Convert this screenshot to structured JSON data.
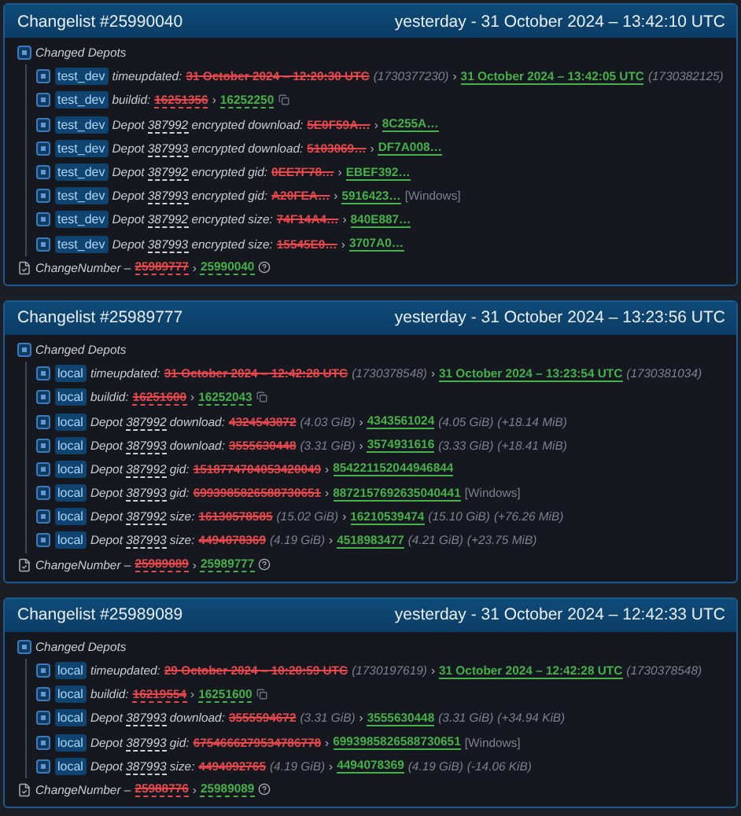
{
  "changelists": [
    {
      "title": "Changelist #25990040",
      "time": "yesterday - 31 October 2024 – 13:42:10 UTC",
      "group": "Changed Depots",
      "rows": [
        {
          "branch": "test_dev",
          "kind": "timestamp",
          "field": "timeupdated:",
          "old": "31 October 2024 – 12:20:30 UTC",
          "old_note": "(1730377230)",
          "arrow": "›",
          "new": "31 October 2024 – 13:42:05 UTC",
          "new_note": "(1730382125)"
        },
        {
          "branch": "test_dev",
          "kind": "buildid",
          "field": "buildid:",
          "old": "16251356",
          "arrow": "›",
          "new": "16252250"
        },
        {
          "branch": "test_dev",
          "kind": "depot",
          "prefix": "Depot",
          "depot": "387992",
          "field": "encrypted download:",
          "old": "5E0F59A…",
          "arrow": "›",
          "new": "8C255A…"
        },
        {
          "branch": "test_dev",
          "kind": "depot",
          "prefix": "Depot",
          "depot": "387993",
          "field": "encrypted download:",
          "old": "5103069…",
          "arrow": "›",
          "new": "DF7A008…"
        },
        {
          "branch": "test_dev",
          "kind": "depot",
          "prefix": "Depot",
          "depot": "387992",
          "field": "encrypted gid:",
          "old": "0EE7F78…",
          "arrow": "›",
          "new": "EBEF392…"
        },
        {
          "branch": "test_dev",
          "kind": "depot",
          "prefix": "Depot",
          "depot": "387993",
          "field": "encrypted gid:",
          "old": "A20FEA…",
          "arrow": "›",
          "new": "5916423…",
          "platform": "[Windows]"
        },
        {
          "branch": "test_dev",
          "kind": "depot",
          "prefix": "Depot",
          "depot": "387992",
          "field": "encrypted size:",
          "old": "74F14A4…",
          "arrow": "›",
          "new": "840E887…"
        },
        {
          "branch": "test_dev",
          "kind": "depot",
          "prefix": "Depot",
          "depot": "387993",
          "field": "encrypted size:",
          "old": "15545E0…",
          "arrow": "›",
          "new": "3707A0…"
        }
      ],
      "change_number": {
        "label": "ChangeNumber –",
        "old": "25989777",
        "arrow": "›",
        "new": "25990040"
      }
    },
    {
      "title": "Changelist #25989777",
      "time": "yesterday - 31 October 2024 – 13:23:56 UTC",
      "group": "Changed Depots",
      "rows": [
        {
          "branch": "local",
          "kind": "timestamp",
          "field": "timeupdated:",
          "old": "31 October 2024 – 12:42:28 UTC",
          "old_note": "(1730378548)",
          "arrow": "›",
          "new": "31 October 2024 – 13:23:54 UTC",
          "new_note": "(1730381034)"
        },
        {
          "branch": "local",
          "kind": "buildid",
          "field": "buildid:",
          "old": "16251600",
          "arrow": "›",
          "new": "16252043"
        },
        {
          "branch": "local",
          "kind": "depot",
          "prefix": "Depot",
          "depot": "387992",
          "field": "download:",
          "old": "4324543872",
          "old_note": "(4.03 GiB)",
          "arrow": "›",
          "new": "4343561024",
          "new_note": "(4.05 GiB)",
          "delta": "(+18.14 MiB)"
        },
        {
          "branch": "local",
          "kind": "depot",
          "prefix": "Depot",
          "depot": "387993",
          "field": "download:",
          "old": "3555630448",
          "old_note": "(3.31 GiB)",
          "arrow": "›",
          "new": "3574931616",
          "new_note": "(3.33 GiB)",
          "delta": "(+18.41 MiB)"
        },
        {
          "branch": "local",
          "kind": "depot",
          "prefix": "Depot",
          "depot": "387992",
          "field": "gid:",
          "old": "1518774704053420049",
          "arrow": "›",
          "new": "854221152044946844"
        },
        {
          "branch": "local",
          "kind": "depot",
          "prefix": "Depot",
          "depot": "387993",
          "field": "gid:",
          "old": "6993985826588730651",
          "arrow": "›",
          "new": "8872157692635040441",
          "platform": "[Windows]"
        },
        {
          "branch": "local",
          "kind": "depot",
          "prefix": "Depot",
          "depot": "387992",
          "field": "size:",
          "old": "16130578585",
          "old_note": "(15.02 GiB)",
          "arrow": "›",
          "new": "16210539474",
          "new_note": "(15.10 GiB)",
          "delta": "(+76.26 MiB)"
        },
        {
          "branch": "local",
          "kind": "depot",
          "prefix": "Depot",
          "depot": "387993",
          "field": "size:",
          "old": "4494078369",
          "old_note": "(4.19 GiB)",
          "arrow": "›",
          "new": "4518983477",
          "new_note": "(4.21 GiB)",
          "delta": "(+23.75 MiB)"
        }
      ],
      "change_number": {
        "label": "ChangeNumber –",
        "old": "25989089",
        "arrow": "›",
        "new": "25989777"
      }
    },
    {
      "title": "Changelist #25989089",
      "time": "yesterday - 31 October 2024 – 12:42:33 UTC",
      "group": "Changed Depots",
      "rows": [
        {
          "branch": "local",
          "kind": "timestamp",
          "field": "timeupdated:",
          "old": "29 October 2024 – 10:20:59 UTC",
          "old_note": "(1730197619)",
          "arrow": "›",
          "new": "31 October 2024 – 12:42:28 UTC",
          "new_note": "(1730378548)"
        },
        {
          "branch": "local",
          "kind": "buildid",
          "field": "buildid:",
          "old": "16219554",
          "arrow": "›",
          "new": "16251600"
        },
        {
          "branch": "local",
          "kind": "depot",
          "prefix": "Depot",
          "depot": "387993",
          "field": "download:",
          "old": "3555594672",
          "old_note": "(3.31 GiB)",
          "arrow": "›",
          "new": "3555630448",
          "new_note": "(3.31 GiB)",
          "delta": "(+34.94 KiB)"
        },
        {
          "branch": "local",
          "kind": "depot",
          "prefix": "Depot",
          "depot": "387993",
          "field": "gid:",
          "old": "6754666279534786778",
          "arrow": "›",
          "new": "6993985826588730651",
          "platform": "[Windows]"
        },
        {
          "branch": "local",
          "kind": "depot",
          "prefix": "Depot",
          "depot": "387993",
          "field": "size:",
          "old": "4494092765",
          "old_note": "(4.19 GiB)",
          "arrow": "›",
          "new": "4494078369",
          "new_note": "(4.19 GiB)",
          "delta": "(-14.06 KiB)"
        }
      ],
      "change_number": {
        "label": "ChangeNumber –",
        "old": "25988776",
        "arrow": "›",
        "new": "25989089"
      }
    }
  ]
}
